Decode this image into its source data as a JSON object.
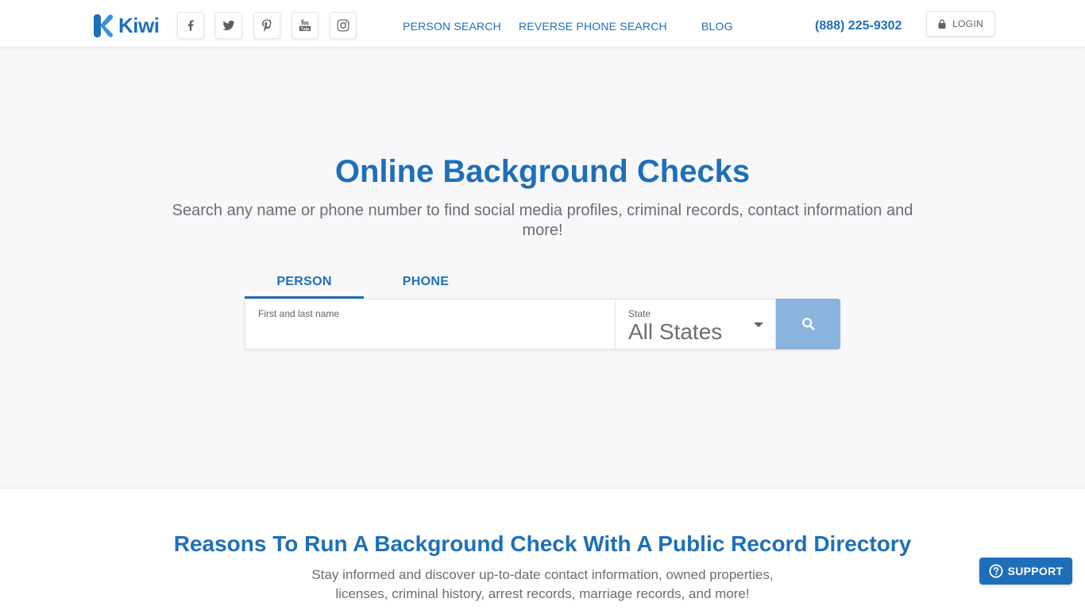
{
  "header": {
    "logo_text": "Kiwi",
    "social": [
      {
        "name": "facebook-icon"
      },
      {
        "name": "twitter-icon"
      },
      {
        "name": "pinterest-icon"
      },
      {
        "name": "youtube-icon"
      },
      {
        "name": "instagram-icon"
      }
    ],
    "nav": {
      "person_search": "PERSON SEARCH",
      "reverse_phone_search": "REVERSE PHONE SEARCH",
      "blog": "BLOG"
    },
    "phone": "(888) 225-9302",
    "login_label": "LOGIN"
  },
  "hero": {
    "title": "Online Background Checks",
    "subtitle": "Search any name or phone number to find social media profiles, criminal records, contact information and more!",
    "tabs": {
      "person": "PERSON",
      "phone": "PHONE"
    },
    "search": {
      "name_label": "First and last name",
      "name_value": "",
      "state_label": "State",
      "state_value": "All States"
    }
  },
  "reasons": {
    "title": "Reasons To Run A Background Check With A Public Record Directory",
    "subtitle": "Stay informed and discover up-to-date contact information, owned properties, licenses, criminal history, arrest records, marriage records, and more!"
  },
  "support": {
    "label": "SUPPORT"
  },
  "colors": {
    "brand_blue": "#1e6fb9",
    "search_button": "#8ab3de",
    "page_background": "#f8f8fa"
  }
}
